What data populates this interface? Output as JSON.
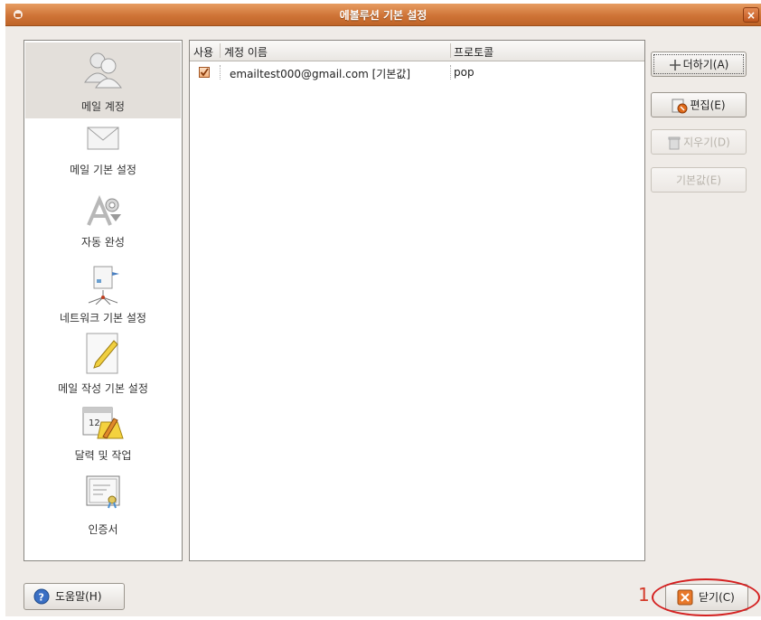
{
  "window": {
    "title": "에볼루션 기본 설정",
    "close_label": "×"
  },
  "sidebar": {
    "items": [
      {
        "label": "메일 계정",
        "icon": "accounts-icon",
        "selected": true
      },
      {
        "label": "메일 기본 설정",
        "icon": "envelope-icon"
      },
      {
        "label": "자동 완성",
        "icon": "autocomplete-icon"
      },
      {
        "label": "네트워크 기본 설정",
        "icon": "network-icon"
      },
      {
        "label": "메일 작성 기본 설정",
        "icon": "compose-icon"
      },
      {
        "label": "달력 및 작업",
        "icon": "calendar-icon"
      },
      {
        "label": "인증서",
        "icon": "certificate-icon"
      }
    ]
  },
  "accounts": {
    "columns": [
      "사용",
      "계정 이름",
      "프로토콜"
    ],
    "rows": [
      {
        "enabled": true,
        "name": "emailtest000@gmail.com [기본값]",
        "protocol": "pop"
      }
    ]
  },
  "buttons": {
    "add": "더하기(A)",
    "edit": "편집(E)",
    "delete": "지우기(D)",
    "default": "기본값(E)",
    "help": "도움말(H)",
    "close": "닫기(C)"
  },
  "annotation": {
    "number": "1"
  },
  "colors": {
    "titlebar": "#cf7437",
    "annotation": "#d42020",
    "accent": "#f08a3c"
  }
}
